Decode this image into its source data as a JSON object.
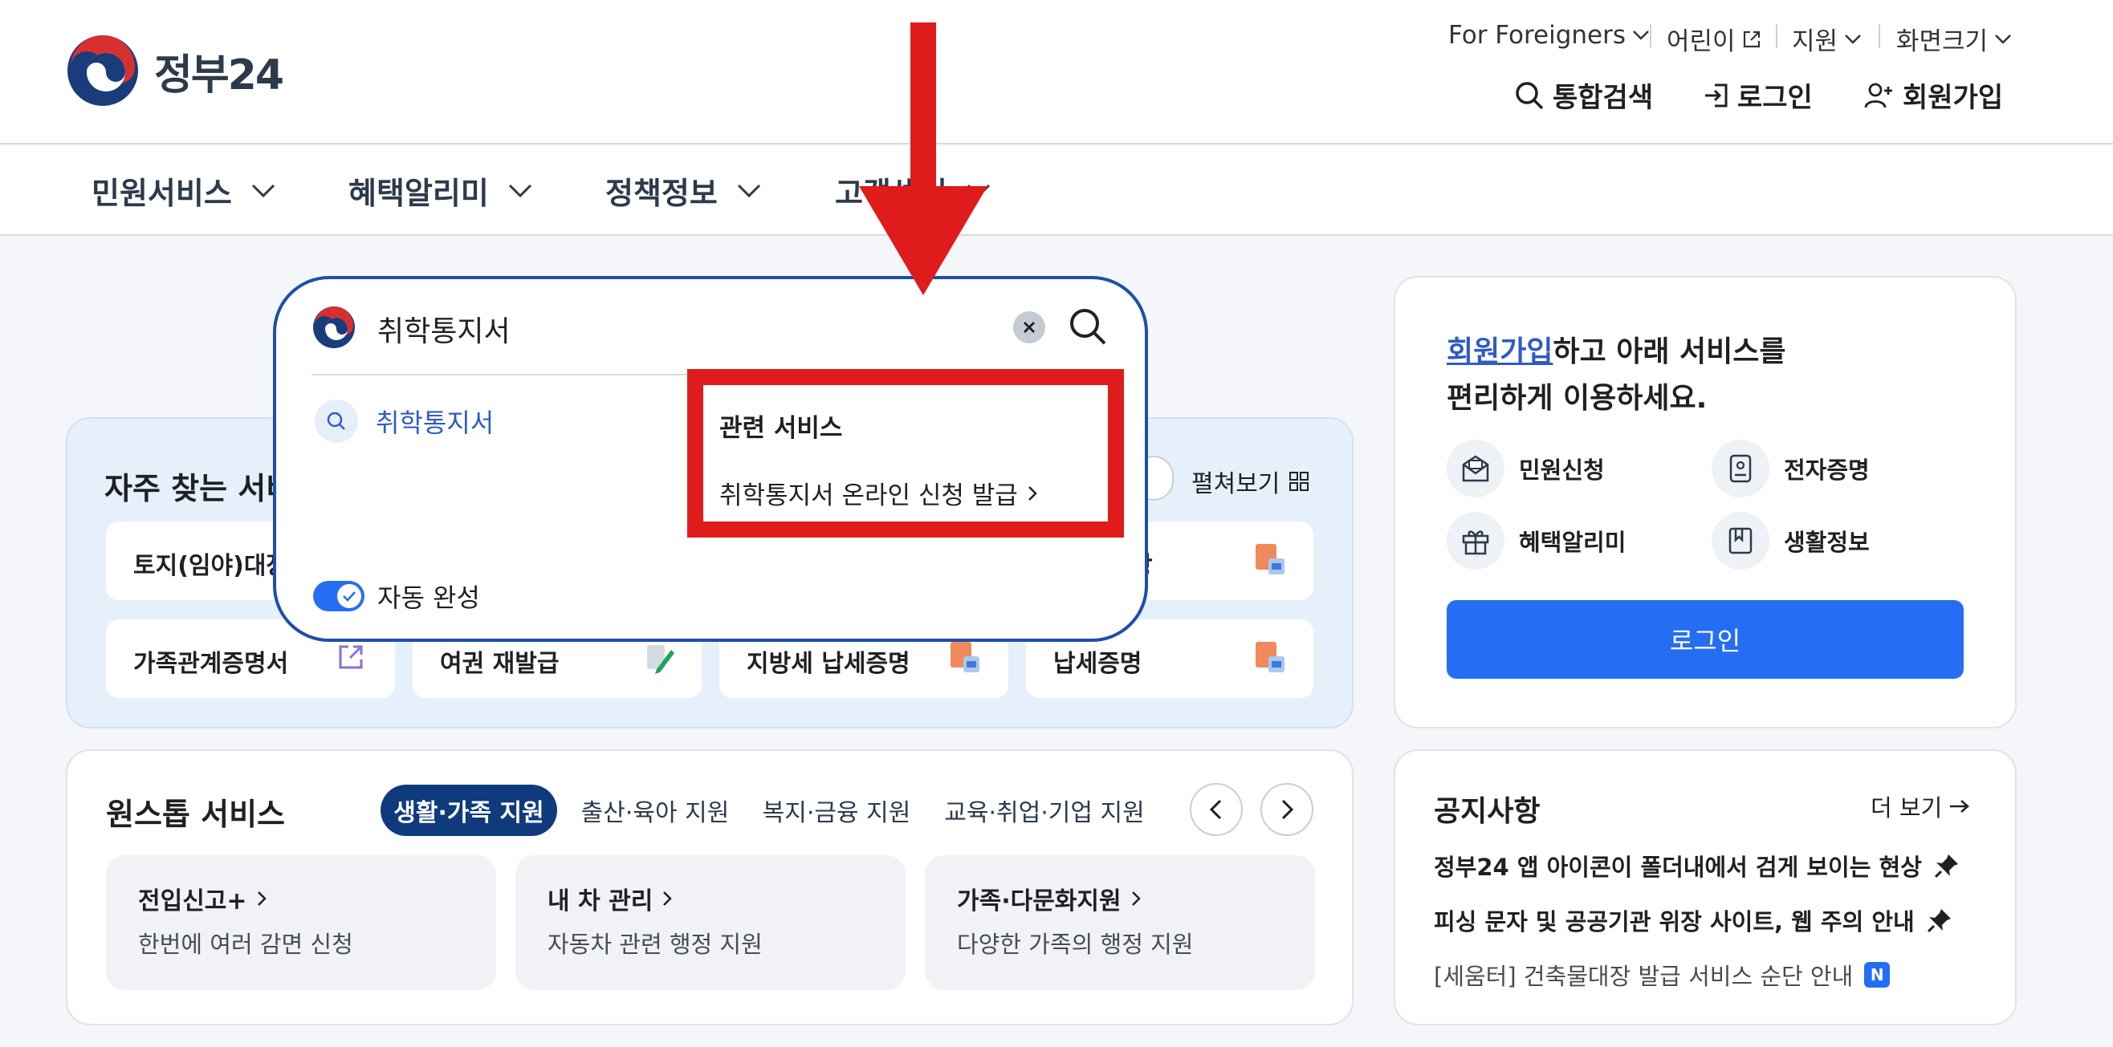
{
  "header": {
    "logo_text": "정부24",
    "utility_nav": [
      {
        "label": "For Foreigners"
      },
      {
        "label": "어린이"
      },
      {
        "label": "지원"
      },
      {
        "label": "화면크기"
      }
    ],
    "actions": {
      "search": "통합검색",
      "login": "로그인",
      "signup": "회원가입"
    }
  },
  "gnb": {
    "items": [
      "민원서비스",
      "혜택알리미",
      "정책정보",
      "고객센터"
    ]
  },
  "frequent": {
    "title": "자주 찾는 서비스",
    "spread_label": "펼쳐보기",
    "tiles": [
      {
        "label": "토지(임야)대장",
        "icon": "document-pdf-icon"
      },
      {
        "label": "",
        "icon": ""
      },
      {
        "label": "",
        "icon": ""
      },
      {
        "label": "장",
        "icon": "document-pdf-icon"
      },
      {
        "label": "가족관계증명서",
        "icon": "external-link-icon"
      },
      {
        "label": "여권 재발급",
        "icon": "pencil-icon"
      },
      {
        "label": "지방세 납세증명",
        "icon": "document-pdf-icon"
      },
      {
        "label": "납세증명",
        "icon": "document-pdf-icon"
      }
    ]
  },
  "onestop": {
    "title": "원스톱 서비스",
    "chips": [
      "생활·가족 지원",
      "출산·육아 지원",
      "복지·금융 지원",
      "교육·취업·기업 지원"
    ],
    "active_chip": "생활·가족 지원",
    "cards": [
      {
        "title": "전입신고+",
        "desc": "한번에 여러 감면 신청"
      },
      {
        "title": "내 차 관리",
        "desc": "자동차 관련 행정 지원"
      },
      {
        "title": "가족·다문화지원",
        "desc": "다양한 가족의 행정 지원"
      }
    ]
  },
  "member": {
    "link_text": "회원가입",
    "line1_rest": "하고 아래 서비스를",
    "line2": "편리하게 이용하세요.",
    "services": [
      {
        "label": "민원신청",
        "icon": "envelope-icon"
      },
      {
        "label": "전자증명",
        "icon": "id-card-icon"
      },
      {
        "label": "혜택알리미",
        "icon": "gift-icon"
      },
      {
        "label": "생활정보",
        "icon": "bookmark-icon"
      }
    ],
    "login_button": "로그인"
  },
  "notice": {
    "title": "공지사항",
    "more": "더 보기",
    "items": [
      {
        "text": "정부24 앱 아이콘이 폴더내에서 검게 보이는 현상",
        "pinned": true
      },
      {
        "text": "피싱 문자 및 공공기관 위장 사이트, 웹 주의 안내",
        "pinned": true
      },
      {
        "text": "[세움터] 건축물대장 발급 서비스 순단 안내",
        "pinned": false,
        "badge": "N"
      }
    ]
  },
  "search": {
    "query": "취학통지서",
    "suggestion": "취학통지서",
    "related_title": "관련 서비스",
    "related_link": "취학통지서 온라인 신청 발급",
    "autocomplete_label": "자동 완성",
    "autocomplete_on": true
  },
  "colors": {
    "primary": "#256ef4",
    "navy": "#0f3b7d",
    "highlight_red": "#e01b1b",
    "overlay_border": "#1c4fa8"
  }
}
